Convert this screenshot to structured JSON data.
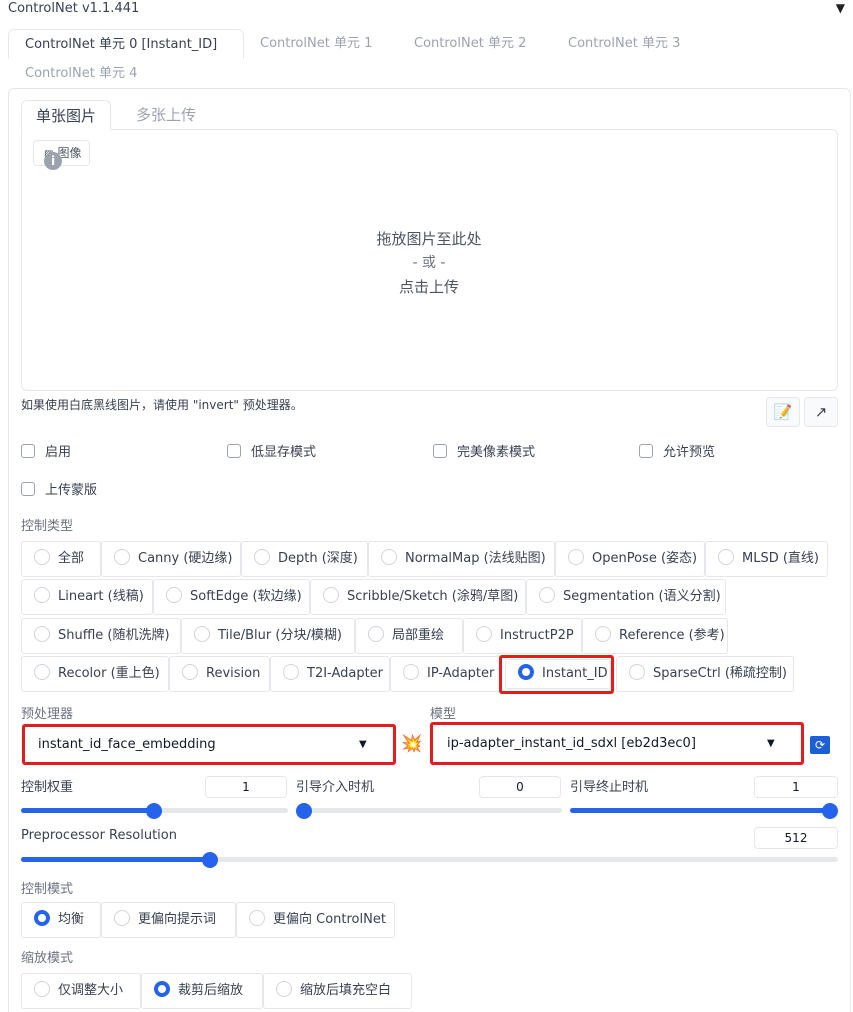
{
  "header": {
    "title": "ControlNet v1.1.441",
    "collapse_icon": "triangle-down-icon"
  },
  "unit_tabs": [
    "ControlNet 单元 0 [Instant_ID]",
    "ControlNet 单元 1",
    "ControlNet 单元 2",
    "ControlNet 单元 3",
    "ControlNet 单元 4"
  ],
  "image_tabs": [
    "单张图片",
    "多张上传"
  ],
  "upload": {
    "label": "图像",
    "line1": "拖放图片至此处",
    "line2": "- 或 -",
    "line3": "点击上传"
  },
  "hint": "如果使用白底黑线图片，请使用 \"invert\" 预处理器。",
  "tools": {
    "edit_icon": "📝",
    "send_icon": "↗"
  },
  "checkboxes": [
    "启用",
    "低显存模式",
    "完美像素模式",
    "允许预览",
    "上传蒙版"
  ],
  "control_type": {
    "label": "控制类型",
    "options": [
      "全部",
      "Canny (硬边缘)",
      "Depth (深度)",
      "NormalMap (法线贴图)",
      "OpenPose (姿态)",
      "MLSD (直线)",
      "Lineart (线稿)",
      "SoftEdge (软边缘)",
      "Scribble/Sketch (涂鸦/草图)",
      "Segmentation (语义分割)",
      "Shuffle (随机洗牌)",
      "Tile/Blur (分块/模糊)",
      "局部重绘",
      "InstructP2P",
      "Reference (参考)",
      "Recolor (重上色)",
      "Revision",
      "T2I-Adapter",
      "IP-Adapter",
      "Instant_ID",
      "SparseCtrl (稀疏控制)"
    ],
    "selected": "Instant_ID"
  },
  "preprocessor": {
    "label": "预处理器",
    "value": "instant_id_face_embedding"
  },
  "run_icon": "💥",
  "model": {
    "label": "模型",
    "value": "ip-adapter_instant_id_sdxl [eb2d3ec0]",
    "refresh_icon": "refresh-icon"
  },
  "sliders": {
    "weight": {
      "label": "控制权重",
      "value": "1",
      "fraction": 0.5
    },
    "start": {
      "label": "引导介入时机",
      "value": "0",
      "fraction": 0.0
    },
    "end": {
      "label": "引导终止时机",
      "value": "1",
      "fraction": 1.0
    },
    "resolution": {
      "label": "Preprocessor Resolution",
      "value": "512",
      "fraction": 0.23
    }
  },
  "control_mode": {
    "label": "控制模式",
    "options": [
      "均衡",
      "更偏向提示词",
      "更偏向 ControlNet"
    ],
    "selected": "均衡"
  },
  "resize_mode": {
    "label": "缩放模式",
    "options": [
      "仅调整大小",
      "裁剪后缩放",
      "缩放后填充空白"
    ],
    "selected": "裁剪后缩放"
  }
}
